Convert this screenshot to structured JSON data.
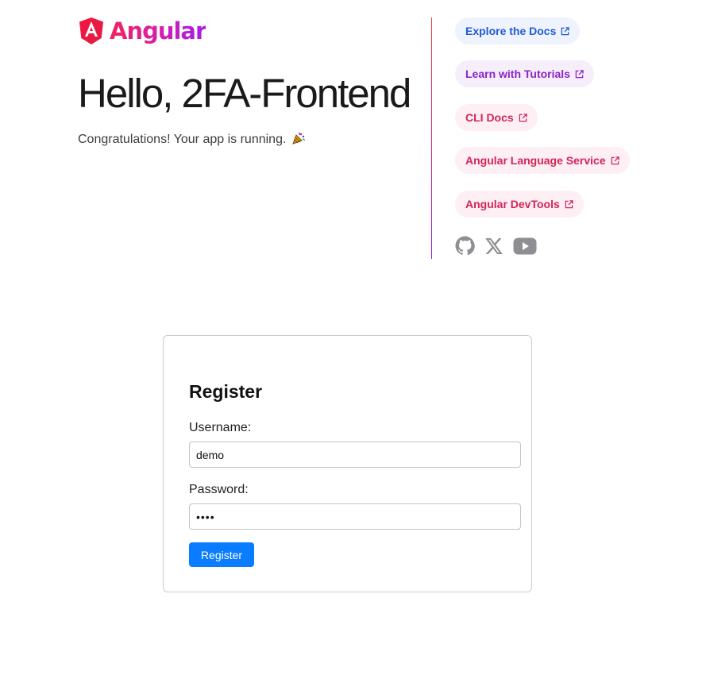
{
  "header": {
    "logo_text": "Angular",
    "title": "Hello, 2FA-Frontend",
    "subtitle": "Congratulations! Your app is running."
  },
  "links": [
    {
      "label": "Explore the Docs",
      "icon": "external-link-icon"
    },
    {
      "label": "Learn with Tutorials",
      "icon": "external-link-icon"
    },
    {
      "label": "CLI Docs",
      "icon": "external-link-icon"
    },
    {
      "label": "Angular Language Service",
      "icon": "external-link-icon"
    },
    {
      "label": "Angular DevTools",
      "icon": "external-link-icon"
    }
  ],
  "socials": [
    "github-icon",
    "x-icon",
    "youtube-icon"
  ],
  "register_form": {
    "title": "Register",
    "username_label": "Username:",
    "username_value": "demo",
    "password_label": "Password:",
    "password_value": "demo",
    "submit_label": "Register"
  },
  "colors": {
    "pill_docs_text": "#1f5bd9",
    "pill_tutorials_text": "#8c23c7",
    "pill_pink_text": "#d3245a",
    "primary_button": "#0a7cff"
  }
}
